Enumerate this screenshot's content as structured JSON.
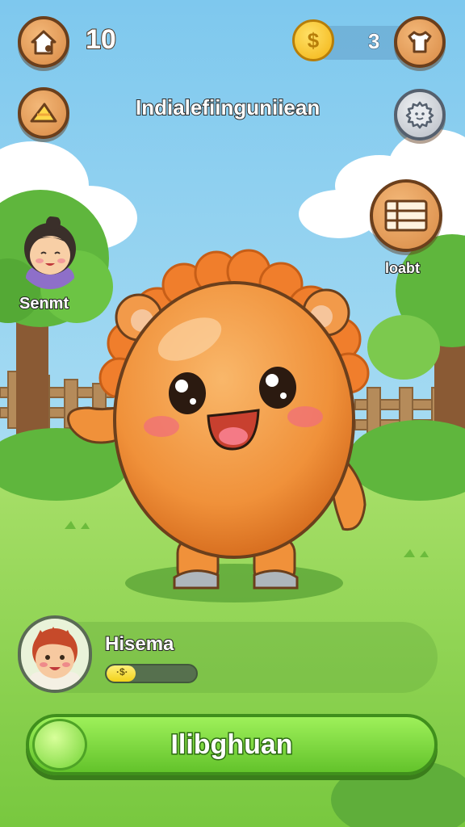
{
  "hud": {
    "home_icon": "home-icon",
    "level": "10",
    "coin_count": "3",
    "coin_icon": "coin-icon",
    "shirt_icon": "shirt-icon",
    "cake_icon": "cake-slice-icon",
    "title": "Indialefiinguniiean",
    "settings_icon": "gear-icon"
  },
  "left_friend": {
    "label": "Senmt",
    "avatar": "girl-avatar"
  },
  "right_menu": {
    "label": "loabt",
    "icon": "list-menu-icon"
  },
  "player": {
    "name": "Hisema",
    "xp_text": "·$·",
    "xp_fraction": 0.32,
    "avatar": "boy-avatar"
  },
  "action_button": {
    "label": "Ilibghuan"
  },
  "colors": {
    "pet": "#f2913b",
    "sky": "#8fd2f2",
    "grass": "#9bdb59",
    "button": "#7bd63a"
  }
}
